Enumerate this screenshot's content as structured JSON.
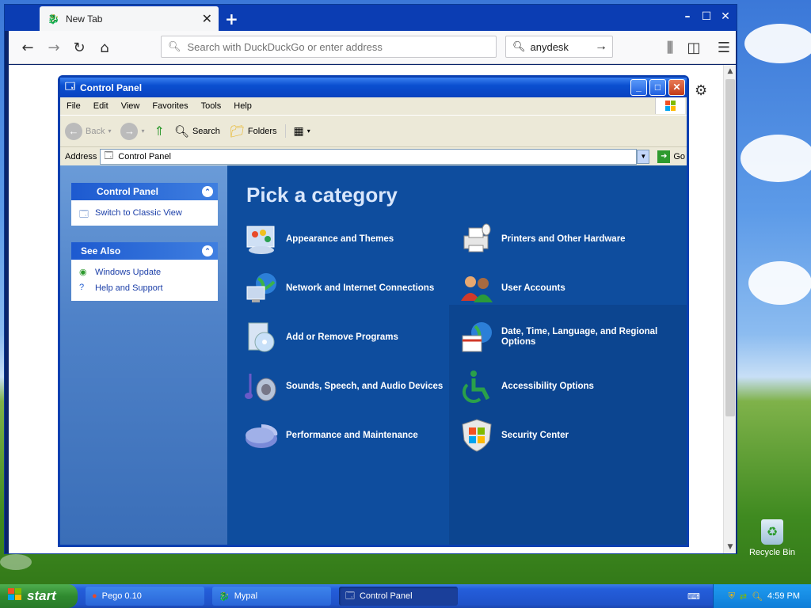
{
  "browser": {
    "tab_title": "New Tab",
    "url_placeholder": "Search with DuckDuckGo or enter address",
    "search_value": "anydesk"
  },
  "control_panel": {
    "title": "Control Panel",
    "menu": [
      "File",
      "Edit",
      "View",
      "Favorites",
      "Tools",
      "Help"
    ],
    "toolbar": {
      "back": "Back",
      "search": "Search",
      "folders": "Folders"
    },
    "address_label": "Address",
    "address_value": "Control Panel",
    "go_label": "Go",
    "left": {
      "panel1_title": "Control Panel",
      "switch_view": "Switch to Classic View",
      "panel2_title": "See Also",
      "windows_update": "Windows Update",
      "help_support": "Help and Support"
    },
    "heading": "Pick a category",
    "categories": [
      "Appearance and Themes",
      "Printers and Other Hardware",
      "Network and Internet Connections",
      "User Accounts",
      "Add or Remove Programs",
      "Date, Time, Language, and Regional Options",
      "Sounds, Speech, and Audio Devices",
      "Accessibility Options",
      "Performance and Maintenance",
      "Security Center"
    ]
  },
  "desktop": {
    "recycle_bin": "Recycle Bin"
  },
  "taskbar": {
    "start": "start",
    "tasks": [
      "Pego 0.10",
      "Mypal",
      "Control Panel"
    ],
    "clock": "4:59 PM"
  }
}
